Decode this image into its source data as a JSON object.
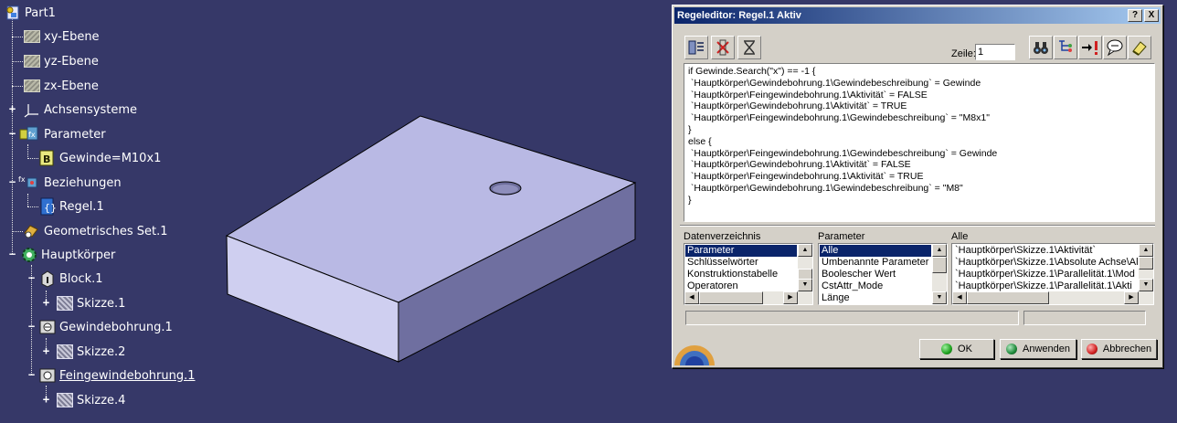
{
  "tree": {
    "root": "Part1",
    "items": [
      {
        "label": "xy-Ebene"
      },
      {
        "label": "yz-Ebene"
      },
      {
        "label": "zx-Ebene"
      },
      {
        "label": "Achsensysteme"
      },
      {
        "label": "Parameter"
      },
      {
        "label": "Gewinde=M10x1"
      },
      {
        "label": "Beziehungen"
      },
      {
        "label": "Regel.1"
      },
      {
        "label": "Geometrisches Set.1"
      },
      {
        "label": "Hauptkörper"
      },
      {
        "label": "Block.1"
      },
      {
        "label": "Skizze.1"
      },
      {
        "label": "Gewindebohrung.1"
      },
      {
        "label": "Skizze.2"
      },
      {
        "label": "Feingewindebohrung.1"
      },
      {
        "label": "Skizze.4"
      }
    ]
  },
  "dialog": {
    "title": "Regeleditor: Regel.1 Aktiv",
    "help_btn": "?",
    "close_btn": "X",
    "zeile_label": "Zeile:",
    "zeile_value": "1",
    "code_lines": [
      "if Gewinde.Search(\"x\") == -1 {",
      " `Hauptkörper\\Gewindebohrung.1\\Gewindebeschreibung` = Gewinde",
      " `Hauptkörper\\Feingewindebohrung.1\\Aktivität` = FALSE",
      " `Hauptkörper\\Gewindebohrung.1\\Aktivität` = TRUE",
      " `Hauptkörper\\Feingewindebohrung.1\\Gewindebeschreibung` = \"M8x1\"",
      "}",
      "else {",
      " `Hauptkörper\\Feingewindebohrung.1\\Gewindebeschreibung` = Gewinde",
      " `Hauptkörper\\Gewindebohrung.1\\Aktivität` = FALSE",
      " `Hauptkörper\\Feingewindebohrung.1\\Aktivität` = TRUE",
      " `Hauptkörper\\Gewindebohrung.1\\Gewindebeschreibung` = \"M8\"",
      "}"
    ],
    "lists": {
      "datenverzeichnis": {
        "header": "Datenverzeichnis",
        "items": [
          "Parameter",
          "Schlüsselwörter",
          "Konstruktionstabelle",
          "Operatoren"
        ],
        "selected": 0
      },
      "parameter": {
        "header": "Parameter",
        "items": [
          "Alle",
          "Umbenannte Parameter",
          "Boolescher Wert",
          "CstAttr_Mode",
          "Länge"
        ],
        "selected": 0
      },
      "alle": {
        "header": "Alle",
        "items": [
          "`Hauptkörper\\Skizze.1\\Aktivität`",
          "`Hauptkörper\\Skizze.1\\Absolute Achse\\Al",
          "`Hauptkörper\\Skizze.1\\Parallelität.1\\Mod",
          "`Hauptkörper\\Skizze.1\\Parallelität.1\\Akti"
        ],
        "selected": -1
      }
    },
    "buttons": {
      "ok": "OK",
      "apply": "Anwenden",
      "cancel": "Abbrechen"
    },
    "colors": {
      "ok_dot": "#1ea01e",
      "apply_dot": "#1e8a3a",
      "cancel_dot": "#d02020"
    }
  }
}
